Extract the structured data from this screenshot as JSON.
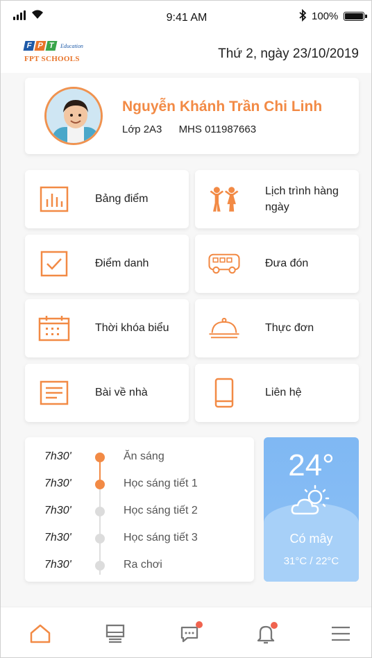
{
  "status_bar": {
    "time": "9:41 AM",
    "battery": "100%"
  },
  "header": {
    "logo_text": "FPT",
    "logo_sub": "Education",
    "logo_name": "FPT SCHOOLS",
    "date": "Thứ 2, ngày 23/10/2019"
  },
  "profile": {
    "name": "Nguyễn Khánh Trần Chi Linh",
    "class": "Lớp 2A3",
    "student_id": "MHS 011987663"
  },
  "menu": [
    {
      "label": "Bảng điểm",
      "icon": "chart-icon"
    },
    {
      "label": "Lịch trình hàng ngày",
      "icon": "children-icon"
    },
    {
      "label": "Điểm danh",
      "icon": "checkbox-icon"
    },
    {
      "label": "Đưa đón",
      "icon": "bus-icon"
    },
    {
      "label": "Thời khóa biểu",
      "icon": "calendar-icon"
    },
    {
      "label": "Thực đơn",
      "icon": "cloche-icon"
    },
    {
      "label": "Bài về nhà",
      "icon": "document-icon"
    },
    {
      "label": "Liên hệ",
      "icon": "phone-icon"
    }
  ],
  "timeline": [
    {
      "time": "7h30'",
      "name": "Ăn sáng",
      "active": true
    },
    {
      "time": "7h30'",
      "name": "Học sáng tiết 1",
      "active": true
    },
    {
      "time": "7h30'",
      "name": "Học sáng tiết 2",
      "active": false
    },
    {
      "time": "7h30'",
      "name": "Học sáng tiết 3",
      "active": false
    },
    {
      "time": "7h30'",
      "name": "Ra chơi",
      "active": false
    }
  ],
  "weather": {
    "temperature": "24°",
    "condition": "Có mây",
    "range": "31°C / 22°C",
    "icon": "partly-cloudy-icon"
  },
  "tabbar": [
    {
      "icon": "home-icon",
      "active": true,
      "badge": false
    },
    {
      "icon": "board-icon",
      "active": false,
      "badge": false
    },
    {
      "icon": "chat-icon",
      "active": false,
      "badge": true
    },
    {
      "icon": "bell-icon",
      "active": false,
      "badge": true
    },
    {
      "icon": "menu-icon",
      "active": false,
      "badge": false
    }
  ],
  "colors": {
    "accent": "#f28a45",
    "weather_top": "#7fb8f3",
    "weather_bottom": "#a7d0f8",
    "badge": "#f0634f"
  }
}
